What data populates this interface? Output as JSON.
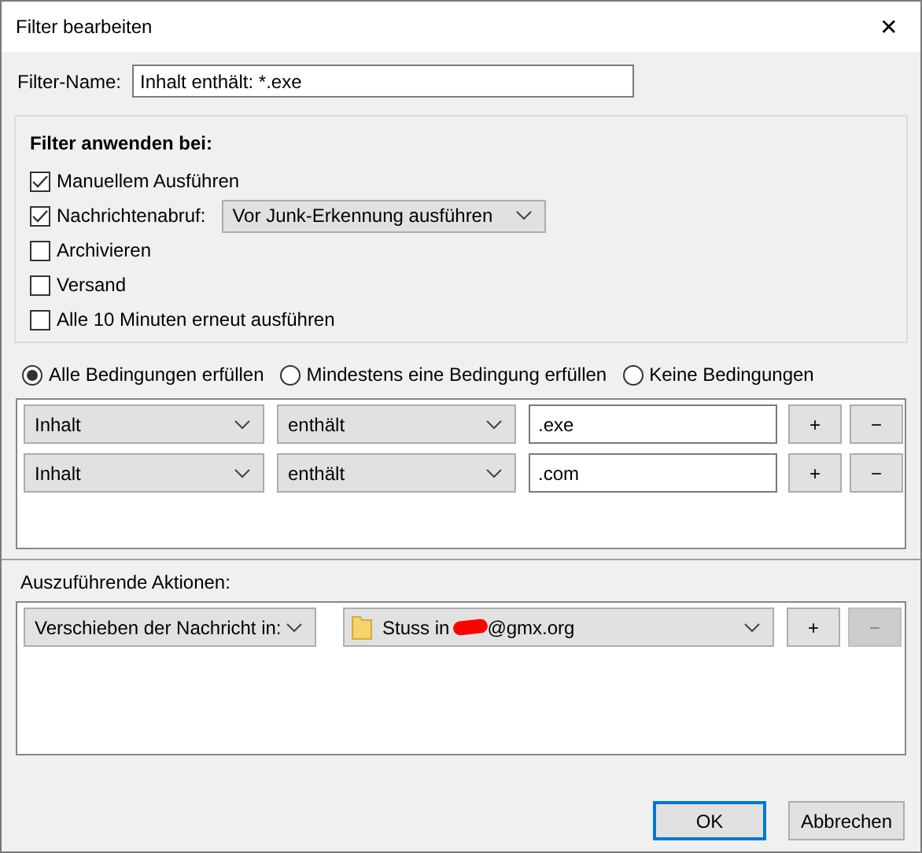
{
  "window": {
    "title": "Filter bearbeiten",
    "close": "✕"
  },
  "filter_name": {
    "label": "Filter-Name:",
    "value": "Inhalt enthält: *.exe"
  },
  "apply_when": {
    "heading": "Filter anwenden bei:",
    "options": [
      {
        "label": "Manuellem Ausführen",
        "checked": true
      },
      {
        "label": "Nachrichtenabruf:",
        "checked": true,
        "dropdown": "Vor Junk-Erkennung ausführen"
      },
      {
        "label": "Archivieren",
        "checked": false
      },
      {
        "label": "Versand",
        "checked": false
      },
      {
        "label": "Alle 10 Minuten erneut ausführen",
        "checked": false
      }
    ]
  },
  "match_modes": [
    {
      "label": "Alle Bedingungen erfüllen",
      "selected": true
    },
    {
      "label": "Mindestens eine Bedingung erfüllen",
      "selected": false
    },
    {
      "label": "Keine Bedingungen",
      "selected": false
    }
  ],
  "conditions": [
    {
      "field": "Inhalt",
      "operator": "enthält",
      "value": ".exe",
      "add": "+",
      "remove": "−"
    },
    {
      "field": "Inhalt",
      "operator": "enthält",
      "value": ".com",
      "add": "+",
      "remove": "−"
    }
  ],
  "actions": {
    "heading": "Auszuführende Aktionen:",
    "items": [
      {
        "action": "Verschieben der Nachricht in:",
        "target_before": "Stuss in",
        "target_after": "@gmx.org",
        "add": "+",
        "remove": "−",
        "remove_disabled": true
      }
    ]
  },
  "buttons": [
    {
      "label": "OK",
      "default": true
    },
    {
      "label": "Abbrechen",
      "default": false
    }
  ]
}
